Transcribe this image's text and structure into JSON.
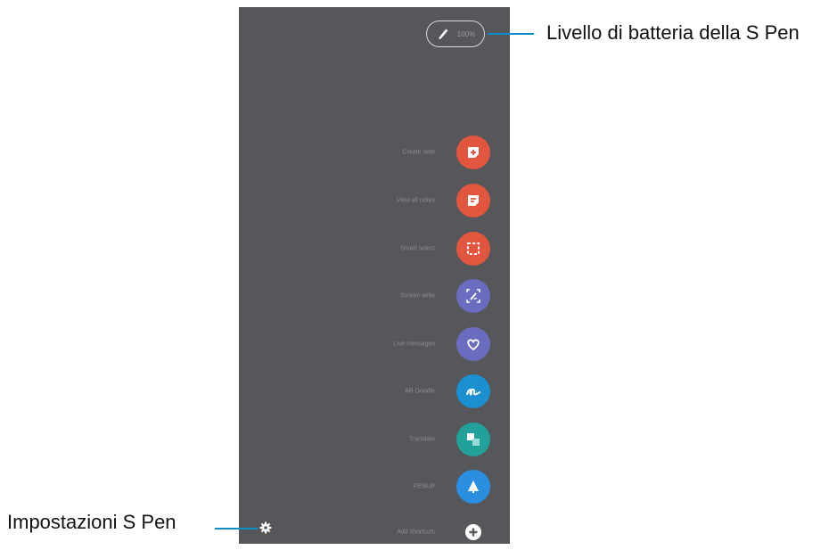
{
  "callouts": {
    "battery_label": "Livello di batteria della S Pen",
    "settings_label": "Impostazioni S Pen"
  },
  "battery": {
    "icon": "s-pen-icon",
    "level_text": "100%"
  },
  "menu": {
    "items": [
      {
        "label": "Create note",
        "icon": "note-add-icon",
        "color": "#e2553e"
      },
      {
        "label": "View all notes",
        "icon": "notes-list-icon",
        "color": "#e2553e"
      },
      {
        "label": "Smart select",
        "icon": "smart-select-icon",
        "color": "#e2553e"
      },
      {
        "label": "Screen write",
        "icon": "screen-write-icon",
        "color": "#6a6cc0"
      },
      {
        "label": "Live messages",
        "icon": "heart-icon",
        "color": "#6a6cc0"
      },
      {
        "label": "AR Doodle",
        "icon": "doodle-icon",
        "color": "#1b8fd0"
      },
      {
        "label": "Translate",
        "icon": "translate-icon",
        "color": "#22a19b"
      },
      {
        "label": "PENUP",
        "icon": "penup-icon",
        "color": "#2a8fe0"
      },
      {
        "label": "Add shortcuts",
        "icon": "plus-icon",
        "color": "#ffffff"
      }
    ]
  },
  "settings": {
    "icon": "gear-icon"
  }
}
